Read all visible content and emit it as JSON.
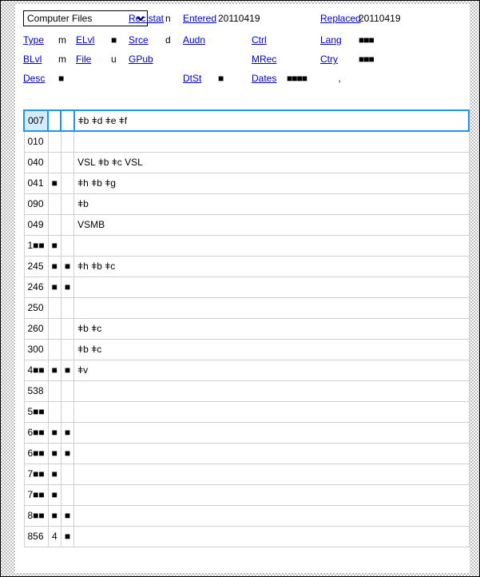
{
  "format": {
    "selected": "Computer Files"
  },
  "fixedFields": {
    "row1": {
      "recstat_label": "Rec stat",
      "recstat_val": "n",
      "entered_label": "Entered",
      "entered_val": "20110419",
      "replaced_label": "Replaced",
      "replaced_val": "20110419"
    },
    "row2": {
      "type_label": "Type",
      "type_val": "m",
      "elvl_label": "ELvl",
      "elvl_val": "■",
      "srce_label": "Srce",
      "srce_val": "d",
      "audn_label": "Audn",
      "audn_val": "",
      "ctrl_label": "Ctrl",
      "ctrl_val": "",
      "lang_label": "Lang",
      "lang_val": "■■■"
    },
    "row3": {
      "blvl_label": "BLvl",
      "blvl_val": "m",
      "file_label": "File",
      "file_val": "u",
      "gpub_label": "GPub",
      "gpub_val": "",
      "mrec_label": "MRec",
      "mrec_val": "",
      "ctry_label": "Ctry",
      "ctry_val": "■■■"
    },
    "row4": {
      "desc_label": "Desc",
      "desc_val": "■",
      "dtst_label": "DtSt",
      "dtst_val": "■",
      "dates_label": "Dates",
      "dates_val1": "■■■■",
      "dates_sep": ",",
      "dates_val2": ""
    }
  },
  "marcRows": [
    {
      "tag": "007",
      "i1": "",
      "i2": "",
      "data": "ǂb ǂd ǂe ǂf",
      "active": true
    },
    {
      "tag": "010",
      "i1": "",
      "i2": "",
      "data": ""
    },
    {
      "tag": "040",
      "i1": "",
      "i2": "",
      "data": "VSL ǂb ǂc VSL"
    },
    {
      "tag": "041",
      "i1": "■",
      "i2": "",
      "data": "ǂh ǂb ǂg"
    },
    {
      "tag": "090",
      "i1": "",
      "i2": "",
      "data": "ǂb"
    },
    {
      "tag": "049",
      "i1": "",
      "i2": "",
      "data": "VSMB"
    },
    {
      "tag": "1■■",
      "i1": "■",
      "i2": "",
      "data": ""
    },
    {
      "tag": "245",
      "i1": "■",
      "i2": "■",
      "data": "ǂh ǂb ǂc"
    },
    {
      "tag": "246",
      "i1": "■",
      "i2": "■",
      "data": ""
    },
    {
      "tag": "250",
      "i1": "",
      "i2": "",
      "data": ""
    },
    {
      "tag": "260",
      "i1": "",
      "i2": "",
      "data": "ǂb ǂc"
    },
    {
      "tag": "300",
      "i1": "",
      "i2": "",
      "data": "ǂb ǂc"
    },
    {
      "tag": "4■■",
      "i1": "■",
      "i2": "■",
      "data": "ǂv"
    },
    {
      "tag": "538",
      "i1": "",
      "i2": "",
      "data": ""
    },
    {
      "tag": "5■■",
      "i1": "",
      "i2": "",
      "data": ""
    },
    {
      "tag": "6■■",
      "i1": "■",
      "i2": "■",
      "data": ""
    },
    {
      "tag": "6■■",
      "i1": "■",
      "i2": "■",
      "data": ""
    },
    {
      "tag": "7■■",
      "i1": "■",
      "i2": "",
      "data": ""
    },
    {
      "tag": "7■■",
      "i1": "■",
      "i2": "",
      "data": ""
    },
    {
      "tag": "8■■",
      "i1": "■",
      "i2": "■",
      "data": ""
    },
    {
      "tag": "856",
      "i1": "4",
      "i2": "■",
      "data": ""
    }
  ]
}
